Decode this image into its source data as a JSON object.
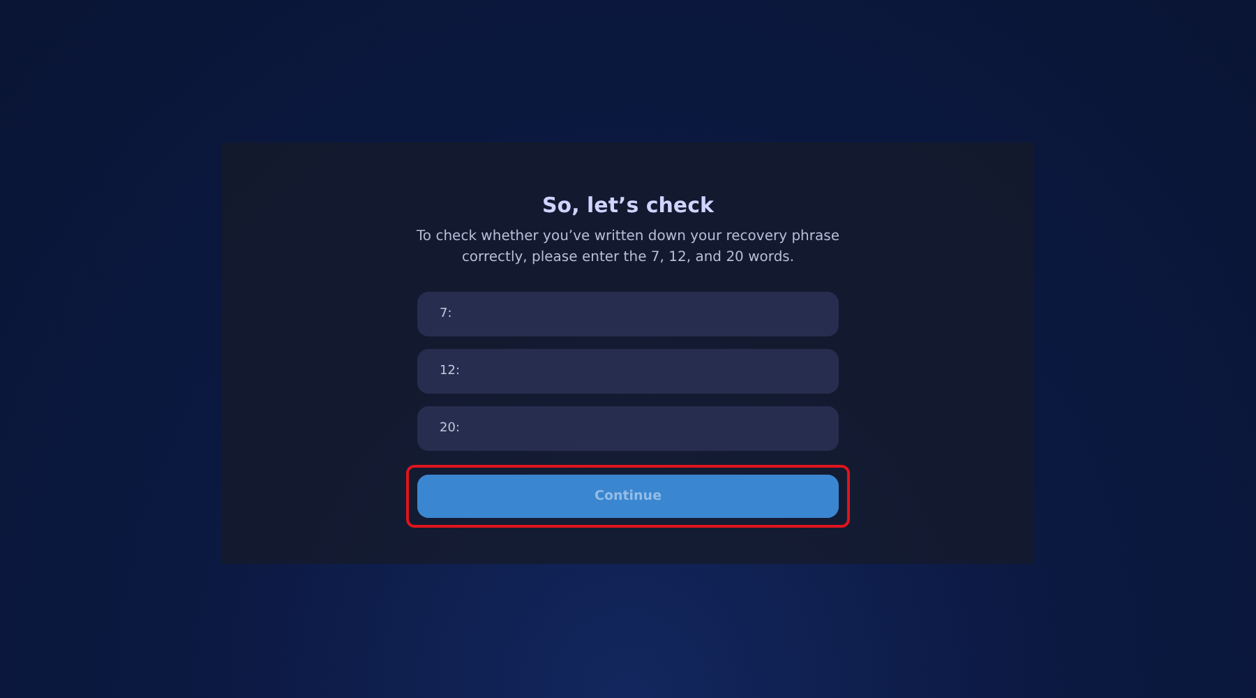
{
  "dialog": {
    "title": "So, let’s check",
    "description": "To check whether you’ve written down your recovery phrase correctly, please enter the 7, 12, and  20 words."
  },
  "fields": [
    {
      "label": "7:"
    },
    {
      "label": "12:"
    },
    {
      "label": "20:"
    }
  ],
  "continue_button": {
    "label": "Continue",
    "highlighted": true
  }
}
